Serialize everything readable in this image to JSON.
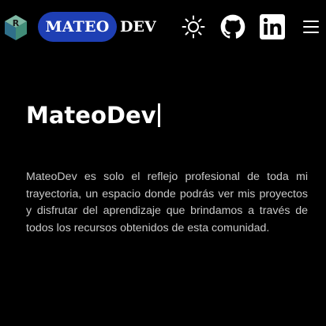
{
  "navbar": {
    "logo_icon": "r-cube-logo-icon",
    "brand_highlight": "MATEO",
    "brand_rest": "DEV",
    "brand_color": "#1e3fb4",
    "theme_toggle_icon": "sun-icon",
    "github_icon": "github-icon",
    "linkedin_icon": "linkedin-icon",
    "menu_icon": "hamburger-menu-icon"
  },
  "hero": {
    "title": "MateoDev",
    "description": "MateoDev es solo el reflejo profesional de toda mi trayectoria, un espacio donde podrás ver mis proyectos y disfrutar del aprendizaje que brindamos a través de todos los recursos obtenidos de esta comunidad."
  }
}
